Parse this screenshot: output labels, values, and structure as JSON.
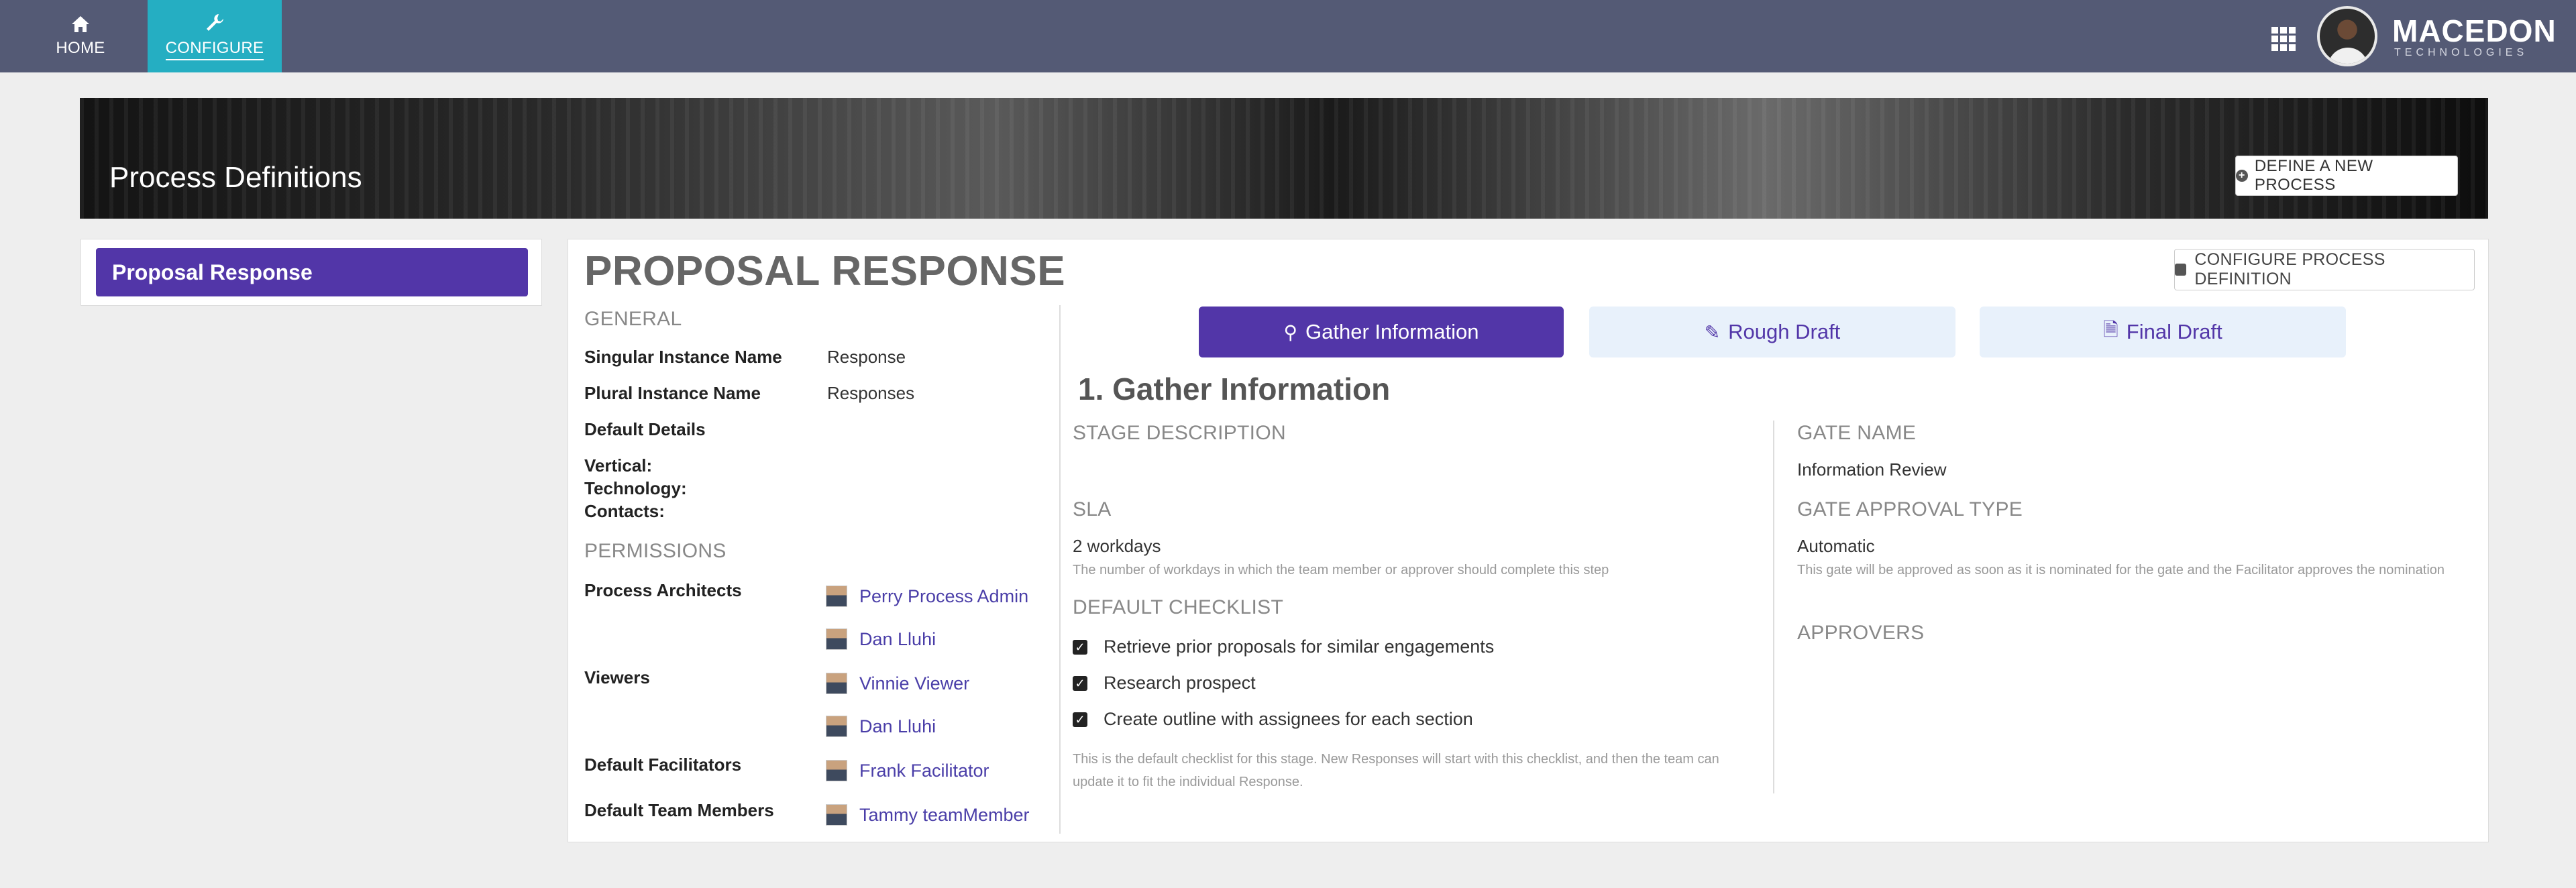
{
  "nav": {
    "home_label": "HOME",
    "configure_label": "CONFIGURE"
  },
  "brand": {
    "name": "MACEDON",
    "sub": "TECHNOLOGIES"
  },
  "banner": {
    "title": "Process Definitions",
    "define_button": "DEFINE A NEW PROCESS"
  },
  "sidebar": {
    "items": [
      {
        "label": "Proposal Response"
      }
    ]
  },
  "main": {
    "title": "PROPOSAL RESPONSE",
    "configure_button": "CONFIGURE PROCESS DEFINITION",
    "general": {
      "heading": "GENERAL",
      "singular_label": "Singular Instance Name",
      "singular_value": "Response",
      "plural_label": "Plural Instance Name",
      "plural_value": "Responses",
      "default_details_label": "Default Details",
      "vertical_label": "Vertical:",
      "technology_label": "Technology:",
      "contacts_label": "Contacts:"
    },
    "permissions": {
      "heading": "PERMISSIONS",
      "architects_label": "Process Architects",
      "architects": [
        "Perry Process Admin",
        "Dan Lluhi"
      ],
      "viewers_label": "Viewers",
      "viewers": [
        "Vinnie Viewer",
        "Dan Lluhi"
      ],
      "facilitators_label": "Default Facilitators",
      "facilitators": [
        "Frank Facilitator"
      ],
      "team_label": "Default Team Members",
      "team": [
        "Tammy teamMember"
      ]
    },
    "tabs": [
      {
        "label": "Gather Information",
        "icon": "search-icon"
      },
      {
        "label": "Rough Draft",
        "icon": "pencil-icon"
      },
      {
        "label": "Final Draft",
        "icon": "document-icon"
      }
    ],
    "stage": {
      "title": "1. Gather Information",
      "description_heading": "STAGE DESCRIPTION",
      "sla_heading": "SLA",
      "sla_value": "2 workdays",
      "sla_note": "The number of workdays in which the team member or approver should complete this step",
      "checklist_heading": "DEFAULT CHECKLIST",
      "checklist": [
        "Retrieve prior proposals for similar engagements",
        "Research prospect",
        "Create outline with assignees for each section"
      ],
      "checklist_note": "This is the default checklist for this stage. New Responses will start with this checklist, and then the team can update it to fit the individual Response.",
      "gate_name_heading": "GATE NAME",
      "gate_name_value": "Information Review",
      "gate_type_heading": "GATE APPROVAL TYPE",
      "gate_type_value": "Automatic",
      "gate_type_note": "This gate will be approved as soon as it is nominated for the gate and the Facilitator approves the nomination",
      "approvers_heading": "APPROVERS"
    }
  },
  "colors": {
    "nav_bg": "#545a75",
    "nav_active": "#25aec2",
    "accent": "#5236a8",
    "tab_inactive": "#e8f1fb"
  }
}
